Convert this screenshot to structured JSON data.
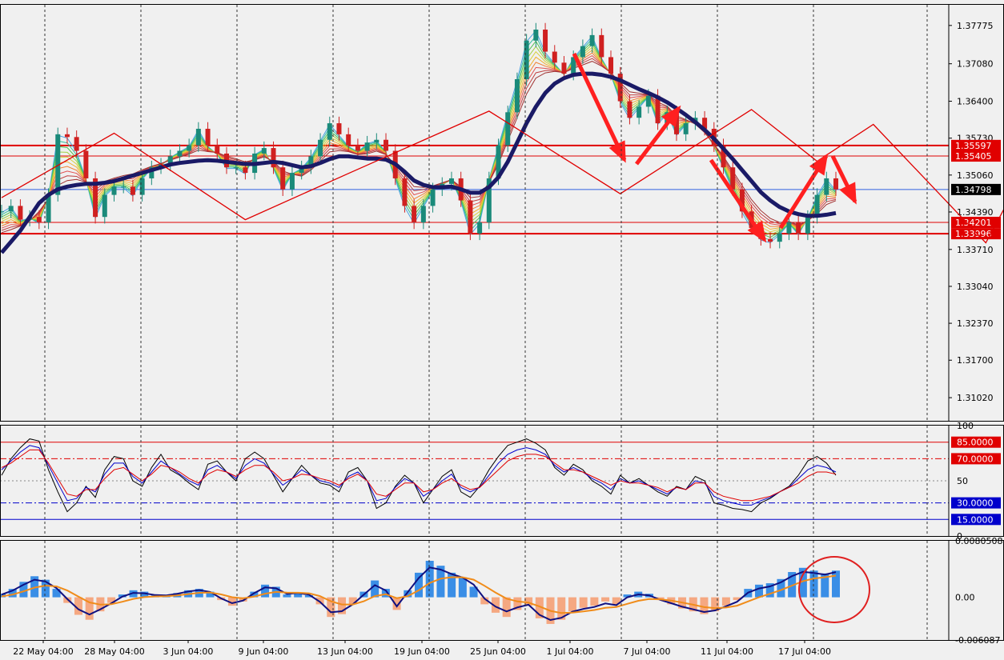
{
  "chart_data": {
    "type": "line",
    "panels": [
      {
        "name": "price",
        "y_range": [
          1.306,
          1.3815
        ],
        "y_ticks": [
          "1.37775",
          "1.37080",
          "1.36400",
          "1.35730",
          "1.35060",
          "1.34390",
          "1.33710",
          "1.33040",
          "1.32370",
          "1.31700",
          "1.31020"
        ],
        "price_marks": [
          {
            "label": "1.35597",
            "value": 1.35597,
            "color": "#e00000"
          },
          {
            "label": "1.35405",
            "value": 1.35405,
            "color": "#e00000"
          },
          {
            "label": "1.34798",
            "value": 1.34798,
            "color": "#000000"
          },
          {
            "label": "1.34201",
            "value": 1.34201,
            "color": "#e00000"
          },
          {
            "label": "1.33996",
            "value": 1.33996,
            "color": "#e00000"
          }
        ],
        "zigzag": [
          1.3465,
          1.3582,
          1.3425,
          1.3509,
          1.3622,
          1.3472,
          1.3625,
          1.3531,
          1.3598,
          1.3383,
          1.351,
          1.3378,
          1.377,
          1.3686,
          1.3785,
          1.372,
          1.354,
          1.3615,
          1.3383,
          1.355
        ],
        "zigzag_x": [
          0,
          12,
          26,
          37,
          52,
          66,
          80,
          87,
          93,
          105,
          109,
          114,
          132,
          142,
          146,
          149,
          163,
          173,
          191,
          205
        ],
        "close_path": [
          1.344,
          1.345,
          1.3425,
          1.343,
          1.342,
          1.347,
          1.358,
          1.3575,
          1.355,
          1.35,
          1.343,
          1.347,
          1.3485,
          1.3485,
          1.347,
          1.35,
          1.352,
          1.3525,
          1.354,
          1.355,
          1.356,
          1.359,
          1.356,
          1.3545,
          1.352,
          1.352,
          1.351,
          1.3545,
          1.3555,
          1.352,
          1.348,
          1.351,
          1.352,
          1.354,
          1.357,
          1.36,
          1.358,
          1.356,
          1.355,
          1.3565,
          1.357,
          1.355,
          1.35,
          1.345,
          1.342,
          1.345,
          1.348,
          1.349,
          1.35,
          1.346,
          1.34,
          1.342,
          1.35,
          1.356,
          1.362,
          1.368,
          1.375,
          1.377,
          1.373,
          1.371,
          1.369,
          1.372,
          1.374,
          1.376,
          1.372,
          1.369,
          1.364,
          1.361,
          1.363,
          1.365,
          1.36,
          1.362,
          1.358,
          1.36,
          1.361,
          1.359,
          1.356,
          1.352,
          1.348,
          1.344,
          1.341,
          1.339,
          1.3385,
          1.34,
          1.342,
          1.34,
          1.343,
          1.347,
          1.35,
          1.348
        ],
        "ribbon": [
          1.3395,
          1.34,
          1.341,
          1.342,
          1.344,
          1.346,
          1.3475,
          1.3485,
          1.349,
          1.349,
          1.349,
          1.3495,
          1.35,
          1.3505,
          1.351,
          1.3515,
          1.352,
          1.3525,
          1.353,
          1.3535,
          1.354,
          1.3545,
          1.3545,
          1.3545,
          1.354,
          1.3535,
          1.353,
          1.353,
          1.3535,
          1.353,
          1.3515,
          1.3505,
          1.35,
          1.351,
          1.3525,
          1.354,
          1.3545,
          1.3545,
          1.354,
          1.354,
          1.3545,
          1.354,
          1.3525,
          1.351,
          1.349,
          1.3485,
          1.3485,
          1.349,
          1.3495,
          1.3485,
          1.347,
          1.347,
          1.349,
          1.352,
          1.356,
          1.36,
          1.364,
          1.367,
          1.3685,
          1.369,
          1.369,
          1.3695,
          1.37,
          1.3705,
          1.37,
          1.369,
          1.3675,
          1.366,
          1.3655,
          1.365,
          1.364,
          1.363,
          1.3615,
          1.3605,
          1.3595,
          1.358,
          1.356,
          1.354,
          1.3515,
          1.349,
          1.3465,
          1.3445,
          1.343,
          1.342,
          1.342,
          1.3415,
          1.342,
          1.343,
          1.3445,
          1.3455
        ],
        "slow_ma": [
          1.3365,
          1.3385,
          1.3405,
          1.343,
          1.3455,
          1.347,
          1.348,
          1.3485,
          1.3488,
          1.349,
          1.349,
          1.3492,
          1.3495,
          1.35,
          1.3505,
          1.351,
          1.3515,
          1.352,
          1.3525,
          1.3528,
          1.353,
          1.3532,
          1.3533,
          1.3532,
          1.353,
          1.3528,
          1.3526,
          1.3526,
          1.3528,
          1.353,
          1.3528,
          1.3524,
          1.352,
          1.3522,
          1.3528,
          1.3535,
          1.354,
          1.354,
          1.3538,
          1.3536,
          1.3536,
          1.3534,
          1.3526,
          1.3512,
          1.3496,
          1.3488,
          1.3484,
          1.3484,
          1.3485,
          1.348,
          1.3474,
          1.3474,
          1.3484,
          1.3502,
          1.353,
          1.3565,
          1.36,
          1.363,
          1.3655,
          1.3672,
          1.3682,
          1.3688,
          1.369,
          1.369,
          1.3688,
          1.3684,
          1.3678,
          1.367,
          1.3662,
          1.3655,
          1.3647,
          1.3638,
          1.3627,
          1.3615,
          1.3602,
          1.3588,
          1.3572,
          1.3554,
          1.3535,
          1.3515,
          1.3495,
          1.3475,
          1.346,
          1.3448,
          1.344,
          1.3435,
          1.3432,
          1.3432,
          1.3434,
          1.3437
        ]
      },
      {
        "name": "oscillator",
        "y_range": [
          0,
          100
        ],
        "y_ticks": [
          "100",
          "50",
          "0"
        ],
        "levels": [
          {
            "label": "85.0000",
            "value": 85,
            "color": "#e00000"
          },
          {
            "label": "70.0000",
            "value": 70,
            "color": "#e00000"
          },
          {
            "label": "30.0000",
            "value": 30,
            "color": "#0000cc"
          },
          {
            "label": "15.0000",
            "value": 15,
            "color": "#0000cc"
          }
        ],
        "series": [
          {
            "color": "#000000",
            "values": [
              55,
              70,
              80,
              88,
              86,
              60,
              40,
              22,
              30,
              45,
              35,
              60,
              72,
              70,
              50,
              45,
              62,
              74,
              60,
              55,
              48,
              42,
              65,
              68,
              58,
              50,
              70,
              76,
              70,
              55,
              40,
              52,
              64,
              55,
              48,
              46,
              40,
              58,
              62,
              50,
              25,
              30,
              45,
              55,
              48,
              30,
              42,
              54,
              60,
              40,
              35,
              45,
              60,
              72,
              82,
              85,
              88,
              84,
              78,
              62,
              55,
              65,
              60,
              50,
              45,
              38,
              55,
              48,
              52,
              46,
              40,
              36,
              45,
              42,
              54,
              50,
              30,
              28,
              25,
              24,
              22,
              30,
              34,
              40,
              45,
              55,
              68,
              72,
              66,
              55
            ]
          },
          {
            "color": "#0000cc",
            "values": [
              60,
              68,
              76,
              82,
              80,
              64,
              48,
              32,
              34,
              44,
              40,
              56,
              66,
              66,
              54,
              48,
              58,
              68,
              62,
              56,
              50,
              46,
              60,
              64,
              58,
              52,
              64,
              70,
              66,
              56,
              46,
              52,
              60,
              55,
              50,
              48,
              44,
              54,
              58,
              50,
              32,
              34,
              44,
              52,
              48,
              36,
              42,
              50,
              56,
              44,
              40,
              44,
              55,
              66,
              74,
              78,
              80,
              78,
              74,
              64,
              58,
              62,
              58,
              52,
              48,
              42,
              52,
              48,
              50,
              46,
              42,
              38,
              44,
              42,
              50,
              48,
              36,
              32,
              30,
              28,
              28,
              32,
              35,
              40,
              44,
              52,
              60,
              64,
              62,
              58
            ]
          },
          {
            "color": "#e00000",
            "values": [
              62,
              66,
              72,
              78,
              78,
              66,
              52,
              38,
              36,
              42,
              42,
              52,
              60,
              62,
              56,
              50,
              56,
              64,
              62,
              58,
              52,
              48,
              56,
              60,
              58,
              54,
              60,
              64,
              64,
              58,
              50,
              52,
              56,
              55,
              52,
              50,
              46,
              52,
              56,
              50,
              38,
              36,
              42,
              48,
              48,
              40,
              42,
              48,
              52,
              46,
              42,
              44,
              52,
              60,
              68,
              72,
              74,
              74,
              72,
              66,
              60,
              60,
              58,
              54,
              50,
              46,
              50,
              48,
              48,
              46,
              44,
              40,
              44,
              42,
              48,
              48,
              40,
              36,
              34,
              32,
              32,
              34,
              36,
              40,
              44,
              48,
              54,
              58,
              58,
              56
            ]
          }
        ]
      },
      {
        "name": "macd",
        "y_range": [
          -0.0060872,
          0.0080508
        ],
        "y_ticks": [
          "0.0080508",
          "0.00",
          "-0.006087"
        ],
        "histogram": [
          0.0005,
          0.0012,
          0.0022,
          0.003,
          0.0025,
          0.0012,
          -0.0008,
          -0.0025,
          -0.0032,
          -0.002,
          -0.0008,
          0.0004,
          0.001,
          0.0008,
          0.0004,
          0.0003,
          0.0006,
          0.001,
          0.0012,
          0.0008,
          -0.0004,
          -0.0012,
          -0.0006,
          0.0008,
          0.0018,
          0.0015,
          0.0004,
          0.0006,
          0.0003,
          -0.001,
          -0.0028,
          -0.0024,
          -0.001,
          0.0008,
          0.0024,
          0.0012,
          -0.0018,
          0.001,
          0.0035,
          0.0052,
          0.0045,
          0.0035,
          0.0028,
          0.0015,
          -0.001,
          -0.0022,
          -0.0028,
          -0.0018,
          -0.0012,
          -0.003,
          -0.0038,
          -0.0032,
          -0.002,
          -0.0015,
          -0.0012,
          -0.0006,
          -0.001,
          0.0004,
          0.0008,
          0.0005,
          -0.0004,
          -0.001,
          -0.0016,
          -0.002,
          -0.0024,
          -0.002,
          -0.0012,
          -0.0004,
          0.0012,
          0.0018,
          0.002,
          0.0026,
          0.0036,
          0.0042,
          0.0038,
          0.0034,
          0.0038
        ]
      }
    ],
    "x_tick_labels": [
      "22 May 04:00",
      "28 May 04:00",
      "3 Jun 04:00",
      "9 Jun 04:00",
      "13 Jun 04:00",
      "19 Jun 04:00",
      "25 Jun 04:00",
      "1 Jul 04:00",
      "7 Jul 04:00",
      "11 Jul 04:00",
      "17 Jul 04:00"
    ],
    "grid": true
  }
}
